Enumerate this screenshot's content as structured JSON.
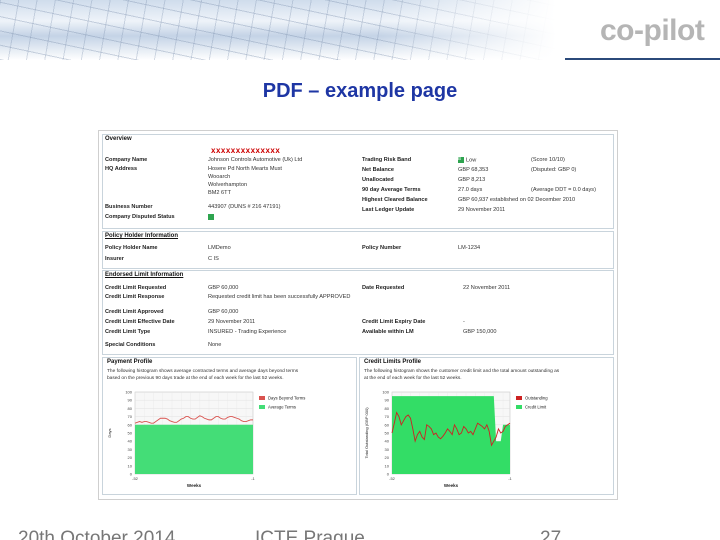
{
  "header": {
    "logo_text": "co-pilot",
    "title": "PDF – example page"
  },
  "doc": {
    "redacted": "xxxxxxxxxxxxxx",
    "overview": {
      "title": "Overview",
      "left": [
        {
          "label": "Company Name",
          "value": "Johnson Controls Automotive (Uk) Ltd"
        },
        {
          "label": "HQ Address",
          "lines": [
            "Hosere Pd North Mearts Must",
            "Wooarch",
            "Wolverhampton",
            "BM2 6TT"
          ]
        },
        {
          "label": "Business Number",
          "value": "443907 (DUNS # 216 47191)"
        },
        {
          "label": "Company Disputed Status",
          "value": ""
        }
      ],
      "right": [
        {
          "label": "Trading Risk Band",
          "value": "Low",
          "extra": "(Score 10/10)"
        },
        {
          "label": "Net Balance",
          "value": "GBP 68,353",
          "extra": "(Disputed: GBP 0)"
        },
        {
          "label": "Unallocated",
          "value": "GBP 8,213",
          "extra": ""
        },
        {
          "label": "90 day Average Terms",
          "value": "27.0 days",
          "extra": "(Average DDT = 0.0 days)"
        },
        {
          "label": "Highest Cleared Balance",
          "value": "GBP 60,937 established on 02 December 2010",
          "extra": ""
        },
        {
          "label": "Last Ledger Update",
          "value": "29 November 2011",
          "extra": ""
        }
      ],
      "band_badge": "B"
    },
    "policy": {
      "title": "Policy Holder Information",
      "items": [
        {
          "label": "Policy Holder Name",
          "value": "LMDemo"
        },
        {
          "label": "Insurer",
          "value": "C IS"
        },
        {
          "label": "Policy Number",
          "value": "LM-1234"
        }
      ]
    },
    "limits": {
      "title": "Endorsed Limit Information",
      "left": [
        {
          "label": "Credit Limit Requested",
          "value": "GBP 60,000"
        },
        {
          "label": "Credit Limit Response",
          "value": "Requested credit limit has been successfully APPROVED"
        },
        {
          "label": "Credit Limit Approved",
          "value": "GBP 60,000"
        },
        {
          "label": "Credit Limit Effective Date",
          "value": "29 November 2011"
        },
        {
          "label": "Credit Limit Type",
          "value": "INSURED - Trading Experience"
        },
        {
          "label": "Special Conditions",
          "value": "None"
        }
      ],
      "right": [
        {
          "label": "Date Requested",
          "value": "22 November 2011"
        },
        {
          "label": "Credit Limit Expiry Date",
          "value": "-"
        },
        {
          "label": "Available within LM",
          "value": "GBP 150,000"
        }
      ]
    },
    "payment_profile": {
      "title": "Payment Profile",
      "desc": [
        "The following histogram shows average contracted terms and average days beyond terms",
        "based on the previous 90 days trade at the end of each week for the last 52 weeks."
      ]
    },
    "credit_profile": {
      "title": "Credit Limits Profile",
      "desc": [
        "The following histogram shows the customer credit limit and the total amount outstanding as",
        "at the end of each week for the last 52 weeks."
      ]
    }
  },
  "footer": {
    "date": "20th October 2014",
    "event": "ICTE Prague",
    "page": "27"
  },
  "chart_data": [
    {
      "type": "area",
      "xlabel": "Weeks",
      "ylabel": "Days",
      "x_ticks": [
        "-52",
        "-1"
      ],
      "ylim": [
        0,
        100
      ],
      "y_ticks": [
        0,
        10,
        20,
        30,
        40,
        50,
        60,
        70,
        80,
        90,
        100
      ],
      "legend_position": "right",
      "series": [
        {
          "name": "Days Beyond Terms",
          "color": "#d9534f",
          "values": [
            62,
            63,
            64,
            63,
            64,
            64,
            63,
            62,
            62,
            64,
            66,
            68,
            68,
            68,
            67,
            65,
            64,
            63,
            63,
            65,
            67,
            68,
            70,
            70,
            68,
            67,
            67,
            69,
            71,
            70,
            68,
            67,
            66,
            66,
            68,
            70,
            70,
            68,
            67,
            67,
            69,
            70,
            70,
            69,
            68,
            67,
            65,
            64,
            64,
            65,
            66,
            66
          ]
        },
        {
          "name": "Average Terms",
          "color": "#44dd77",
          "values": [
            60,
            60,
            60,
            60,
            60,
            60,
            60,
            60,
            60,
            60,
            60,
            60,
            60,
            60,
            60,
            60,
            60,
            60,
            60,
            60,
            60,
            60,
            60,
            60,
            60,
            60,
            60,
            60,
            60,
            60,
            60,
            60,
            60,
            60,
            60,
            60,
            60,
            60,
            60,
            60,
            60,
            60,
            60,
            60,
            60,
            60,
            60,
            60,
            60,
            60,
            60,
            60
          ]
        }
      ]
    },
    {
      "type": "area",
      "xlabel": "Weeks",
      "ylabel": "Total Outstanding (GBP 000)",
      "x_ticks": [
        "-52",
        "-1"
      ],
      "ylim": [
        0,
        100
      ],
      "y_ticks": [
        0,
        10,
        20,
        30,
        40,
        50,
        60,
        70,
        80,
        90,
        100
      ],
      "legend_position": "right",
      "series": [
        {
          "name": "Outstanding",
          "color": "#cc2222",
          "values": [
            50,
            62,
            75,
            70,
            60,
            65,
            70,
            72,
            68,
            55,
            40,
            48,
            52,
            45,
            42,
            60,
            58,
            55,
            48,
            50,
            45,
            43,
            46,
            50,
            55,
            52,
            48,
            60,
            55,
            48,
            50,
            58,
            55,
            50,
            52,
            48,
            55,
            62,
            60,
            58,
            55,
            60,
            52,
            35,
            40,
            45,
            55,
            50,
            52,
            58,
            60,
            62
          ]
        },
        {
          "name": "Credit Limit",
          "color": "#33dd66",
          "values": [
            95,
            95,
            95,
            95,
            95,
            95,
            95,
            95,
            95,
            95,
            95,
            95,
            95,
            95,
            95,
            95,
            95,
            95,
            95,
            95,
            95,
            95,
            95,
            95,
            95,
            95,
            95,
            95,
            95,
            95,
            95,
            95,
            95,
            95,
            95,
            95,
            95,
            95,
            95,
            95,
            95,
            95,
            95,
            95,
            95,
            40,
            40,
            40,
            60,
            60,
            60,
            60
          ]
        }
      ]
    }
  ]
}
